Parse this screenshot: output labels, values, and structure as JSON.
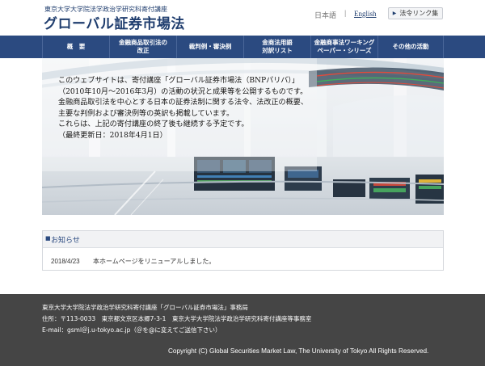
{
  "header": {
    "subtitle": "東京大学大学院法学政治学研究科寄付講座",
    "title": "グローバル証券市場法",
    "lang_ja": "日本語",
    "lang_separator": "|",
    "lang_en": "English",
    "links_button": "法令リンク集",
    "links_button_icon": "caret-right-icon"
  },
  "nav": {
    "items": [
      {
        "label": "概　要"
      },
      {
        "label": "金融商品取引法の\n改正"
      },
      {
        "label": "裁判例・審決例"
      },
      {
        "label": "金商法用語\n対訳リスト"
      },
      {
        "label": "金融商事法ワーキング\nペーパー・シリーズ"
      },
      {
        "label": "その他の活動"
      }
    ]
  },
  "hero": {
    "lines": [
      "このウェブサイトは、寄付講座「グローバル証券市場法（BNPパリバ）」",
      "（2010年10月～2016年3月）の活動の状況と成果等を公開するものです。",
      "金融商品取引法を中心とする日本の証券法制に関する法令、法改正の概要、",
      "主要な判例および審決例等の英訳も掲載しています。",
      "これらは、上記の寄付講座の終了後も継続する予定です。",
      "（最終更新日：2018年4月1日）"
    ]
  },
  "notice": {
    "title": "お知らせ",
    "items": [
      {
        "date": "2018/4/23",
        "text": "本ホームページをリニューアルしました。"
      }
    ]
  },
  "footer": {
    "line1": "東京大学大学院法学政治学研究科寄付講座「グローバル証券市場法」事務局",
    "line2": "住所：〒113-0033　東京都文京区本郷7-3-1　東京大学大学院法学政治学研究科寄付講座等事務室",
    "line3": "E-mail：gsml＠j.u-tokyo.ac.jp（＠を@に変えてご送信下さい）",
    "copyright": "Copyright (C) Global Securities Market Law, The University of Tokyo All Rights Reserved."
  },
  "colors": {
    "brand_navy": "#1f3d6e",
    "nav_bg": "#2b4a80",
    "footer_bg": "#454545"
  }
}
